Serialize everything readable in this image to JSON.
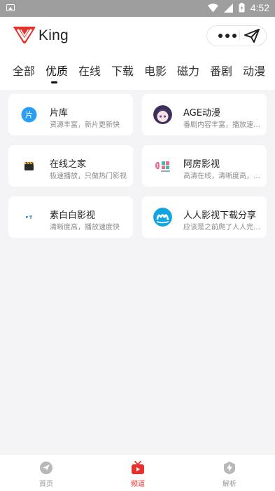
{
  "status_bar": {
    "time": "4:52"
  },
  "app": {
    "name": "King",
    "brand_color": "#e5322d"
  },
  "tabs": [
    {
      "label": "全部"
    },
    {
      "label": "优质"
    },
    {
      "label": "在线"
    },
    {
      "label": "下载"
    },
    {
      "label": "电影"
    },
    {
      "label": "磁力"
    },
    {
      "label": "番剧"
    },
    {
      "label": "动漫"
    }
  ],
  "active_tab": "优质",
  "cards": [
    {
      "title": "片库",
      "desc": "资源丰富，新片更新快",
      "icon": "pianku-icon"
    },
    {
      "title": "AGE动漫",
      "desc": "番剧内容丰富，播放速度快",
      "icon": "anime-avatar-icon"
    },
    {
      "title": "在线之家",
      "desc": "极速播放，只做热门影视",
      "icon": "clapperboard-icon"
    },
    {
      "title": "阿房影视",
      "desc": "高清在线，清晰度高，更新快",
      "icon": "afang-logo-icon"
    },
    {
      "title": "素白白影视",
      "desc": "清晰度高，播放速度快",
      "icon": "subaibai-icon"
    },
    {
      "title": "人人影视下载分享",
      "desc": "应该是之前爬了人人完整资源",
      "icon": "renren-icon"
    }
  ],
  "bottom_nav": [
    {
      "label": "首页",
      "icon": "compass-icon",
      "active": false
    },
    {
      "label": "频道",
      "icon": "tv-icon",
      "active": true
    },
    {
      "label": "解析",
      "icon": "lightning-shield-icon",
      "active": false
    }
  ]
}
